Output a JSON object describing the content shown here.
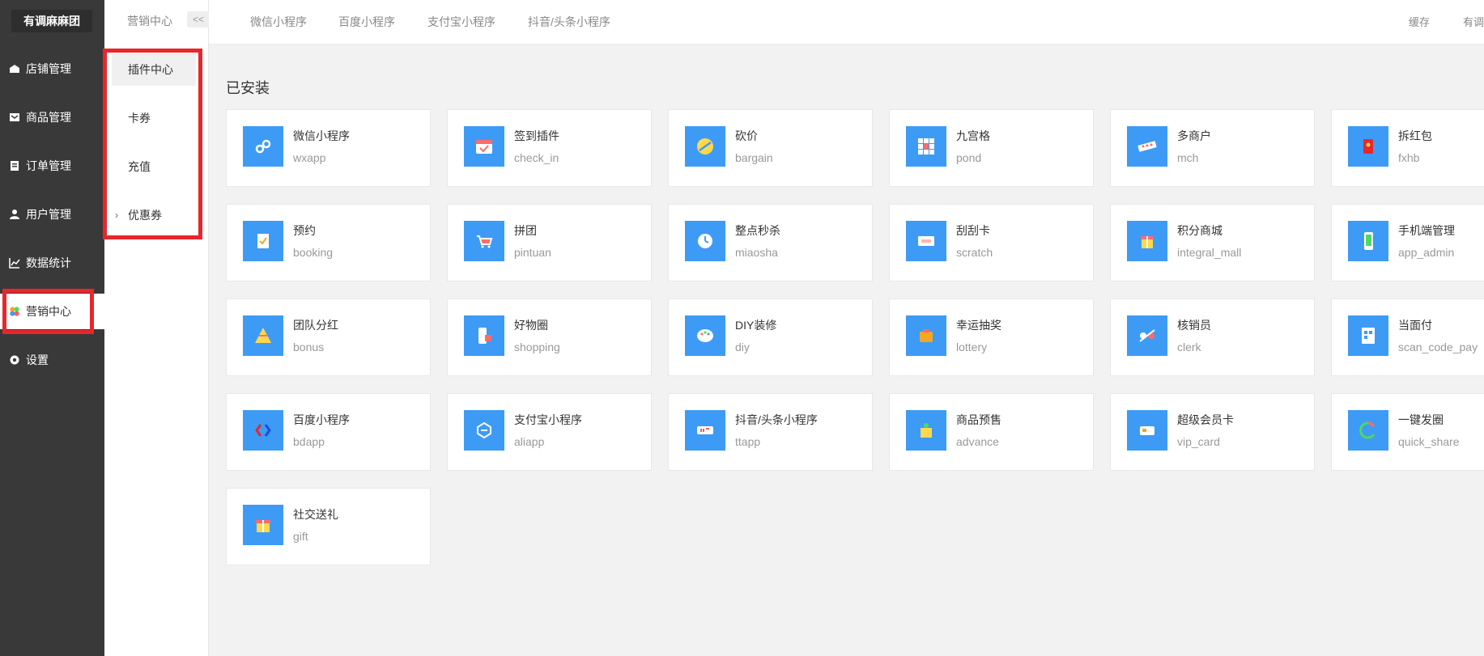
{
  "brand": "有调麻麻团",
  "sidebar": {
    "items": [
      {
        "label": "店铺管理",
        "icon": "store-icon"
      },
      {
        "label": "商品管理",
        "icon": "goods-icon"
      },
      {
        "label": "订单管理",
        "icon": "order-icon"
      },
      {
        "label": "用户管理",
        "icon": "user-icon"
      },
      {
        "label": "数据统计",
        "icon": "chart-icon"
      },
      {
        "label": "营销中心",
        "icon": "marketing-icon"
      },
      {
        "label": "设置",
        "icon": "settings-icon"
      }
    ],
    "active": "营销中心"
  },
  "submenu": {
    "crumb": "营销中心",
    "collapse": "<<",
    "items": [
      {
        "label": "插件中心"
      },
      {
        "label": "卡券"
      },
      {
        "label": "充值"
      },
      {
        "label": "优惠券"
      }
    ]
  },
  "topbar": {
    "tabs": [
      "微信小程序",
      "百度小程序",
      "支付宝小程序",
      "抖音/头条小程序"
    ],
    "right": [
      "缓存",
      "有调"
    ]
  },
  "main": {
    "section_title": "已安装",
    "plugins": [
      {
        "name": "微信小程序",
        "code": "wxapp",
        "icon": "wechat-link-icon"
      },
      {
        "name": "签到插件",
        "code": "check_in",
        "icon": "calendar-check-icon"
      },
      {
        "name": "砍价",
        "code": "bargain",
        "icon": "knife-icon"
      },
      {
        "name": "九宫格",
        "code": "pond",
        "icon": "grid-icon"
      },
      {
        "name": "多商户",
        "code": "mch",
        "icon": "shop-icon"
      },
      {
        "name": "拆红包",
        "code": "fxhb",
        "icon": "red-envelope-icon"
      },
      {
        "name": "预约",
        "code": "booking",
        "icon": "booking-icon"
      },
      {
        "name": "拼团",
        "code": "pintuan",
        "icon": "cart-icon"
      },
      {
        "name": "整点秒杀",
        "code": "miaosha",
        "icon": "clock-icon"
      },
      {
        "name": "刮刮卡",
        "code": "scratch",
        "icon": "scratch-card-icon"
      },
      {
        "name": "积分商城",
        "code": "integral_mall",
        "icon": "gift-box-icon"
      },
      {
        "name": "手机端管理",
        "code": "app_admin",
        "icon": "phone-icon"
      },
      {
        "name": "团队分红",
        "code": "bonus",
        "icon": "pyramid-icon"
      },
      {
        "name": "好物圈",
        "code": "shopping",
        "icon": "phone-bag-icon"
      },
      {
        "name": "DIY装修",
        "code": "diy",
        "icon": "palette-icon"
      },
      {
        "name": "幸运抽奖",
        "code": "lottery",
        "icon": "prize-icon"
      },
      {
        "name": "核销员",
        "code": "clerk",
        "icon": "verify-icon"
      },
      {
        "name": "当面付",
        "code": "scan_code_pay",
        "icon": "scan-pay-icon"
      },
      {
        "name": "百度小程序",
        "code": "bdapp",
        "icon": "baidu-icon"
      },
      {
        "name": "支付宝小程序",
        "code": "aliapp",
        "icon": "alipay-icon"
      },
      {
        "name": "抖音/头条小程序",
        "code": "ttapp",
        "icon": "tiktok-icon"
      },
      {
        "name": "商品预售",
        "code": "advance",
        "icon": "presale-icon"
      },
      {
        "name": "超级会员卡",
        "code": "vip_card",
        "icon": "vip-card-icon"
      },
      {
        "name": "一键发圈",
        "code": "quick_share",
        "icon": "share-ring-icon"
      },
      {
        "name": "社交送礼",
        "code": "gift",
        "icon": "gift-icon"
      }
    ]
  }
}
